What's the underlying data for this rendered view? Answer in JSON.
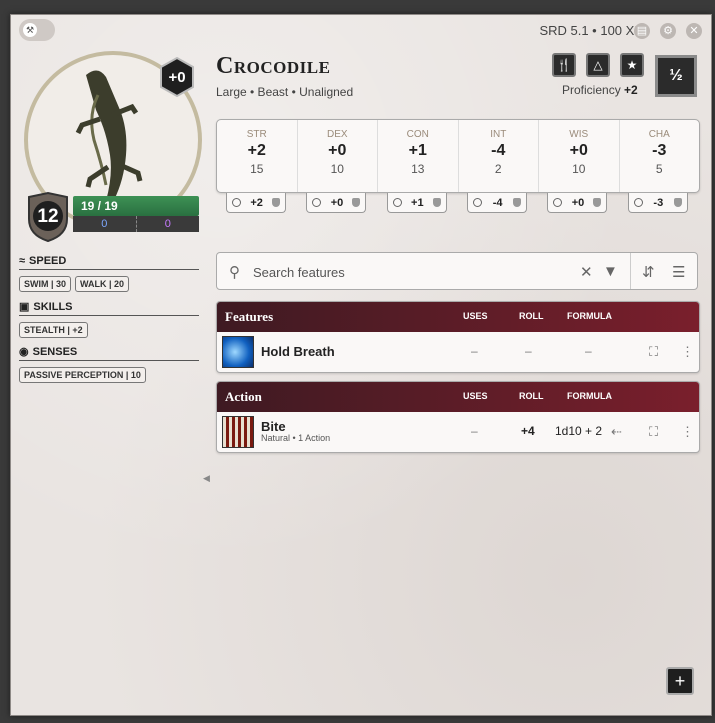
{
  "header": {
    "srd": "SRD 5.1 • 100 XP"
  },
  "actor": {
    "name": "Crocodile",
    "details": "Large • Beast • Unaligned",
    "portrait_modifier": "+0",
    "ac": "12",
    "hp": "19 / 19",
    "temp_hp": "0",
    "temp_max": "0",
    "cr": "½",
    "proficiency_label": "Proficiency",
    "proficiency_value": "+2"
  },
  "sidebar": {
    "speed_label": "SPEED",
    "speed": [
      "SWIM | 30",
      "WALK | 20"
    ],
    "skills_label": "SKILLS",
    "skills": [
      "STEALTH | +2"
    ],
    "senses_label": "SENSES",
    "senses": [
      "PASSIVE PERCEPTION | 10"
    ]
  },
  "abilities": [
    {
      "label": "STR",
      "mod": "+2",
      "score": "15",
      "save": "+2"
    },
    {
      "label": "DEX",
      "mod": "+0",
      "score": "10",
      "save": "+0"
    },
    {
      "label": "CON",
      "mod": "+1",
      "score": "13",
      "save": "+1"
    },
    {
      "label": "INT",
      "mod": "-4",
      "score": "2",
      "save": "-4"
    },
    {
      "label": "WIS",
      "mod": "+0",
      "score": "10",
      "save": "+0"
    },
    {
      "label": "CHA",
      "mod": "-3",
      "score": "5",
      "save": "-3"
    }
  ],
  "search": {
    "placeholder": "Search features"
  },
  "features": {
    "title": "Features",
    "cols": {
      "uses": "USES",
      "roll": "ROLL",
      "formula": "FORMULA"
    },
    "items": [
      {
        "name": "Hold Breath",
        "uses": "–",
        "roll": "–",
        "formula": "–"
      }
    ]
  },
  "actions": {
    "title": "Action",
    "cols": {
      "uses": "USES",
      "roll": "ROLL",
      "formula": "FORMULA"
    },
    "items": [
      {
        "name": "Bite",
        "sub": "Natural • 1 Action",
        "uses": "–",
        "roll": "+4",
        "formula": "1d10 + 2"
      }
    ]
  }
}
